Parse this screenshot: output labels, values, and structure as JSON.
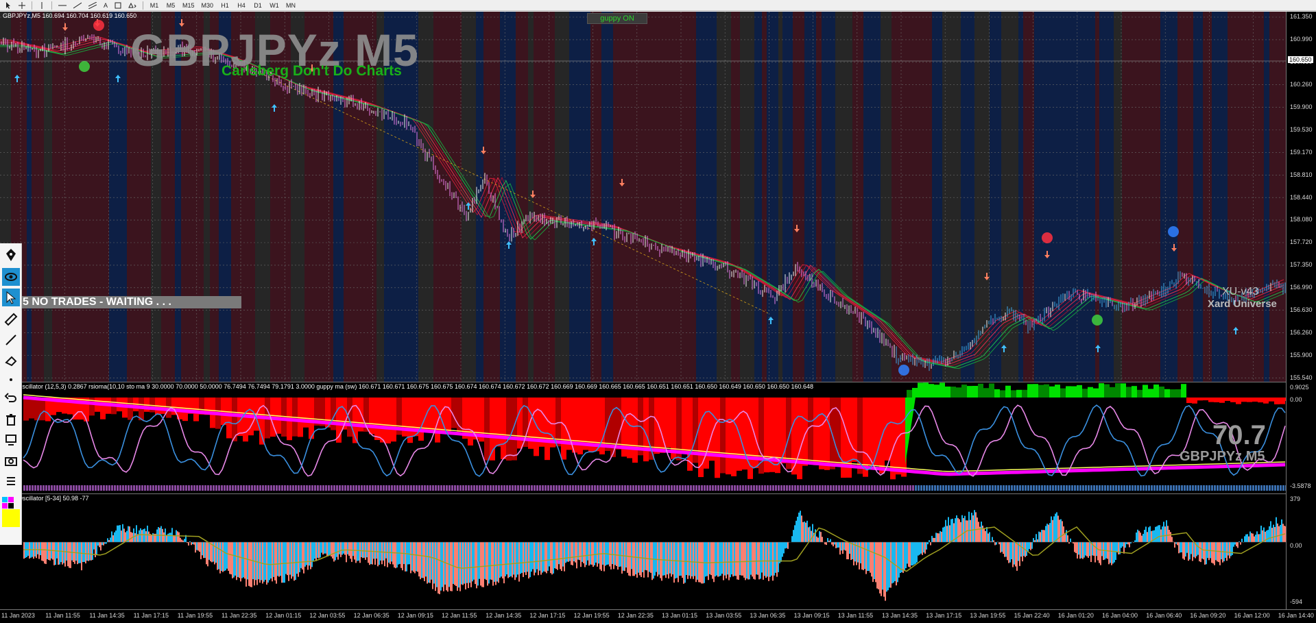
{
  "toolbar": {
    "timeframes": [
      "M1",
      "M5",
      "M15",
      "M30",
      "H1",
      "H4",
      "D1",
      "W1",
      "MN"
    ],
    "tools": [
      "cursor-icon",
      "crosshair-icon",
      "vertical-line-icon",
      "horizontal-line-icon",
      "trendline-icon",
      "channel-icon",
      "text-tool-icon",
      "label-tool-icon",
      "shapes-tool-icon"
    ],
    "text_tool_label": "A"
  },
  "chart": {
    "header": "GBPJPYz,M5  160.694 160.704 160.619 160.650",
    "symbol_watermark": "GBPJPYz M5",
    "subtitle": "Carlsberg Don't Do Charts",
    "guppy_button": "guppy ON",
    "status_banner": "5  NO TRADES - WAITING . . .",
    "brand_version": "XU-v43",
    "brand_name": "Xard Universe",
    "current_price": "160.650",
    "price_axis": [
      "161.350",
      "160.990",
      "160.650",
      "160.260",
      "159.900",
      "159.530",
      "159.170",
      "158.810",
      "158.440",
      "158.080",
      "157.720",
      "157.350",
      "156.990",
      "156.630",
      "156.260",
      "155.900",
      "155.540"
    ],
    "time_axis": [
      "11 Jan 2023",
      "11 Jan 11:55",
      "11 Jan 14:35",
      "11 Jan 17:15",
      "11 Jan 19:55",
      "11 Jan 22:35",
      "12 Jan 01:15",
      "12 Jan 03:55",
      "12 Jan 06:35",
      "12 Jan 09:15",
      "12 Jan 11:55",
      "12 Jan 14:35",
      "12 Jan 17:15",
      "12 Jan 19:55",
      "12 Jan 22:35",
      "13 Jan 01:15",
      "13 Jan 03:55",
      "13 Jan 06:35",
      "13 Jan 09:15",
      "13 Jan 11:55",
      "13 Jan 14:35",
      "13 Jan 17:15",
      "13 Jan 19:55",
      "15 Jan 22:40",
      "16 Jan 01:20",
      "16 Jan 04:00",
      "16 Jan 06:40",
      "16 Jan 09:20",
      "16 Jan 12:00",
      "16 Jan 14:40"
    ]
  },
  "oscillator": {
    "header_name": "Xard Oscillator (12,5,3)",
    "header_values": "0.2867  rsioma(10,10 sto ma 9  30.0000 70.0000 50.0000  76.7494 76.7494 79.1791 3.0000  guppy ma (sw) 160.671 160.671 160.675 160.675 160.674 160.674 160.672 160.672 160.669 160.669 160.665 160.665 160.651 160.651 160.650 160.649 160.650 160.650 160.648",
    "axis": [
      "0.9025",
      "0.00",
      "-3.5878"
    ],
    "big_value": "70.7",
    "symbol_label": "GBPJPYz M5"
  },
  "elliott": {
    "header": "Elliot Oscillator [5-34]  50.98 -77",
    "axis": [
      "379",
      "0.00",
      "-594"
    ]
  },
  "colors": {
    "bear_bg": "#3b141e",
    "bull_bg": "#0d1f45",
    "neutral_bg": "#262626",
    "candle_down": "#e87be8",
    "candle_up": "#3ea8e8",
    "ma_down": "#e0203c",
    "ma_up": "#22d050",
    "osc_red": "#ff0000",
    "osc_green": "#00e000",
    "elliott_up": "#19b8f0",
    "elliott_down": "#fa8072"
  },
  "left_panel": [
    "pen-icon",
    "eye-icon",
    "select-arrow-icon",
    "ruler-icon",
    "line-tool-icon",
    "eraser-icon",
    "dot-icon",
    "undo-icon",
    "trash-icon",
    "screen-icon",
    "camera-icon",
    "list-icon",
    "color-palette-icon"
  ]
}
